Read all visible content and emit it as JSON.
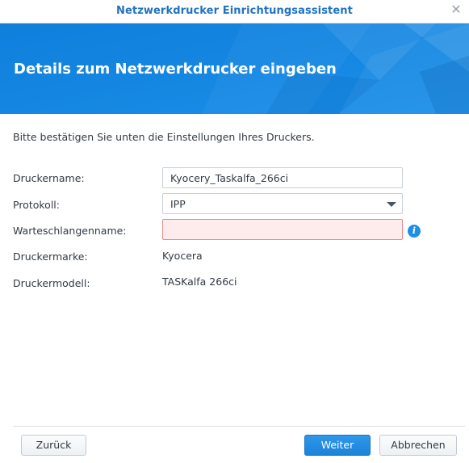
{
  "window": {
    "title": "Netzwerkdrucker Einrichtungsassistent",
    "close_icon": "close-icon"
  },
  "banner": {
    "title": "Details zum Netzwerkdrucker eingeben",
    "color": "#1085e0"
  },
  "intro_text": "Bitte bestätigen Sie unten die Einstellungen Ihres Druckers.",
  "form": {
    "printer_name": {
      "label": "Druckername:",
      "value": "Kyocery_Taskalfa_266ci"
    },
    "protocol": {
      "label": "Protokoll:",
      "value": "IPP"
    },
    "queue_name": {
      "label": "Warteschlangenname:",
      "value": "",
      "state": "error"
    },
    "brand": {
      "label": "Druckermarke:",
      "value": "Kyocera"
    },
    "model": {
      "label": "Druckermodell:",
      "value": "TASKalfa 266ci"
    }
  },
  "footer": {
    "back_label": "Zurück",
    "next_label": "Weiter",
    "cancel_label": "Abbrechen"
  },
  "colors": {
    "accent": "#1f72c4",
    "primary_button": "#1b83d8",
    "error_field": "#fdeceb"
  }
}
